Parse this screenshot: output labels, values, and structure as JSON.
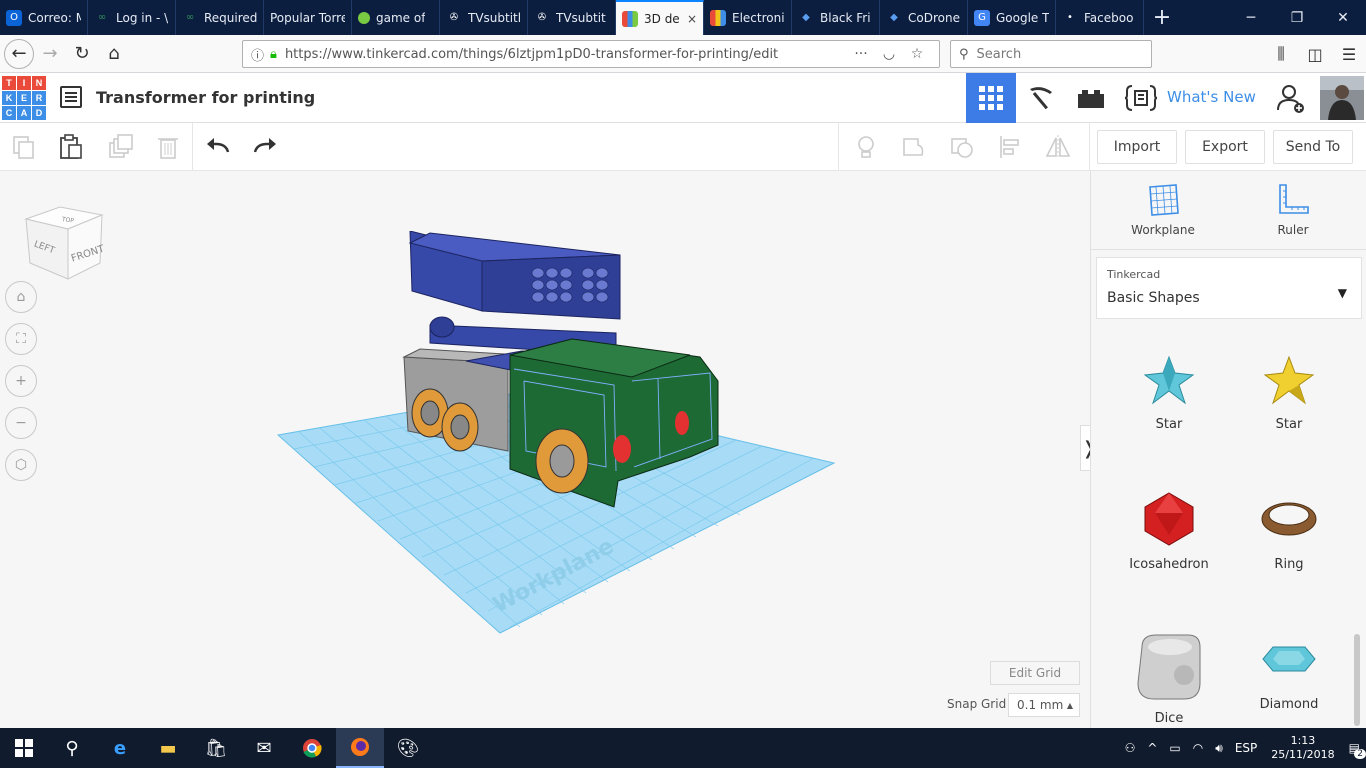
{
  "browser": {
    "tabs": [
      {
        "label": "Correo: M",
        "icon": "outlook-icon",
        "color": "#0a64d8"
      },
      {
        "label": "Log in - \\",
        "icon": "link-icon",
        "color": "#2f8f5b"
      },
      {
        "label": "Required",
        "icon": "link-icon",
        "color": "#2f8f5b"
      },
      {
        "label": "Popular Torre",
        "icon": "",
        "color": ""
      },
      {
        "label": "game of",
        "icon": "leaf-icon",
        "color": "#7ac943"
      },
      {
        "label": "TVsubtitl",
        "icon": "film-icon",
        "color": "#ffffff"
      },
      {
        "label": "TVsubtit",
        "icon": "film-icon",
        "color": "#ffffff"
      },
      {
        "label": "3D de",
        "icon": "tinkercad-icon",
        "color": "#e94a3a"
      },
      {
        "label": "Electroni",
        "icon": "electronics-icon",
        "color": "#f0c419"
      },
      {
        "label": "Black Fri",
        "icon": "drop-icon",
        "color": "#5a9df0"
      },
      {
        "label": "CoDrone",
        "icon": "drop-icon",
        "color": "#5a9df0"
      },
      {
        "label": "Google T",
        "icon": "google-translate-icon",
        "color": "#4285f4"
      },
      {
        "label": "Faceboo",
        "icon": "dot-icon",
        "color": "#ffffff"
      }
    ],
    "url": "https://www.tinkercad.com/things/6lztjpm1pD0-transformer-for-printing/edit",
    "search_placeholder": "Search"
  },
  "app": {
    "logo_letters": [
      "T",
      "I",
      "N",
      "K",
      "E",
      "R",
      "C",
      "A",
      "D"
    ],
    "design_title": "Transformer for printing",
    "whats_new": "What's New"
  },
  "toolbar": {
    "import": "Import",
    "export": "Export",
    "send_to": "Send To"
  },
  "workspace": {
    "viewcube": {
      "top": "TOP",
      "left": "LEFT",
      "front": "FRONT"
    },
    "workplane_label": "Workplane",
    "edit_grid": "Edit Grid",
    "snap_grid_label": "Snap Grid",
    "snap_grid_value": "0.1 mm"
  },
  "panel": {
    "tools": [
      "Workplane",
      "Ruler"
    ],
    "library_sub": "Tinkercad",
    "library_main": "Basic Shapes",
    "shapes": [
      "Star",
      "Star",
      "Icosahedron",
      "Ring",
      "Dice",
      "Diamond"
    ]
  },
  "taskbar": {
    "lang": "ESP",
    "time": "1:13",
    "date": "25/11/2018",
    "notifications": "2"
  }
}
